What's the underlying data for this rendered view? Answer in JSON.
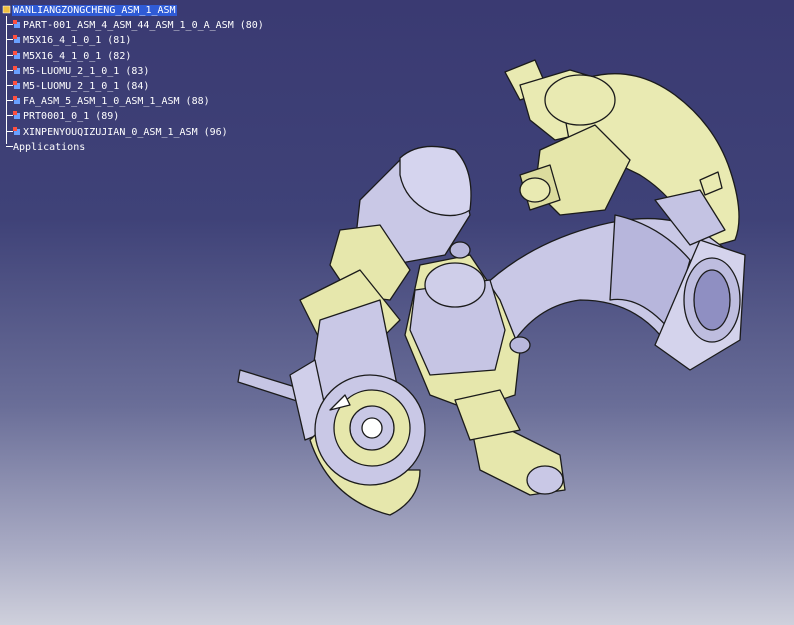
{
  "tree": {
    "root": "WANLIANGZONGCHENG_ASM_1_ASM",
    "items": [
      "PART-001_ASM_4_ASM_44_ASM_1_0_A_ASM (80)",
      "M5X16_4_1_0_1 (81)",
      "M5X16_4_1_0_1 (82)",
      "M5-LUOMU_2_1_0_1 (83)",
      "M5-LUOMU_2_1_0_1 (84)",
      "FA_ASM_5_ASM_1_0_ASM_1_ASM (88)",
      "PRT0001_0_1 (89)",
      "XINPENYOUQIZUJIAN_0_ASM_1_ASM (96)"
    ],
    "applications": "Applications"
  },
  "colors": {
    "part_yellow": "#e8e9b0",
    "part_lavender": "#c8c8e6",
    "edge": "#1a1a1a",
    "selection": "#2f5bd6"
  }
}
